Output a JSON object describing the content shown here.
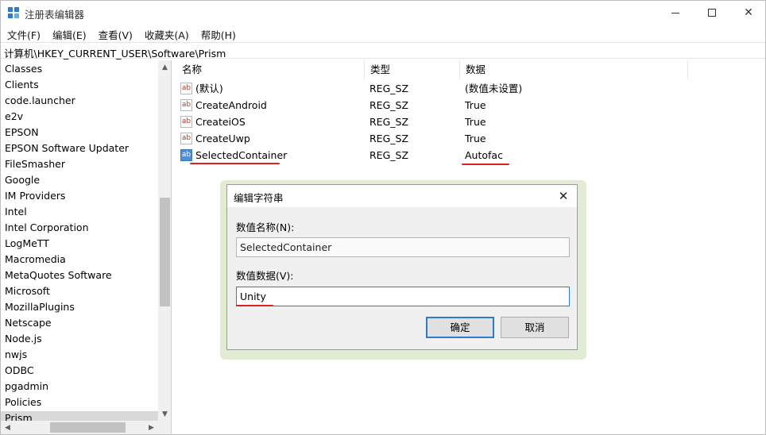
{
  "window": {
    "title": "注册表编辑器",
    "minimize": "—",
    "maximize": "☐",
    "close": "✕"
  },
  "menu": [
    {
      "label": "文件(F)"
    },
    {
      "label": "编辑(E)"
    },
    {
      "label": "查看(V)"
    },
    {
      "label": "收藏夹(A)"
    },
    {
      "label": "帮助(H)"
    }
  ],
  "address": "计算机\\HKEY_CURRENT_USER\\Software\\Prism",
  "tree": {
    "items": [
      "Classes",
      "Clients",
      "code.launcher",
      "e2v",
      "EPSON",
      "EPSON Software Updater",
      "FileSmasher",
      "Google",
      "IM Providers",
      "Intel",
      "Intel Corporation",
      "LogMeTT",
      "Macromedia",
      "MetaQuotes Software",
      "Microsoft",
      "MozillaPlugins",
      "Netscape",
      "Node.js",
      "nwjs",
      "ODBC",
      "pgadmin",
      "Policies",
      "Prism"
    ],
    "selected": "Prism",
    "scroll_up": "▲",
    "scroll_down": "▼",
    "scroll_left": "◀",
    "scroll_right": "▶"
  },
  "values": {
    "headers": {
      "name": "名称",
      "type": "类型",
      "data": "数据"
    },
    "rows": [
      {
        "icon": "ab",
        "name": "(默认)",
        "type": "REG_SZ",
        "data": "(数值未设置)"
      },
      {
        "icon": "ab",
        "name": "CreateAndroid",
        "type": "REG_SZ",
        "data": "True"
      },
      {
        "icon": "ab",
        "name": "CreateiOS",
        "type": "REG_SZ",
        "data": "True"
      },
      {
        "icon": "ab",
        "name": "CreateUwp",
        "type": "REG_SZ",
        "data": "True"
      },
      {
        "icon": "ab",
        "name": "SelectedContainer",
        "type": "REG_SZ",
        "data": "Autofac"
      }
    ]
  },
  "dialog": {
    "title": "编辑字符串",
    "close": "✕",
    "name_label": "数值名称(N):",
    "name_value": "SelectedContainer",
    "data_label": "数值数据(V):",
    "data_value": "Unity",
    "ok": "确定",
    "cancel": "取消"
  },
  "colors": {
    "accent": "#2b7bd1",
    "annotation": "#e0201c",
    "dialog_glow": "#e2ecd5"
  }
}
